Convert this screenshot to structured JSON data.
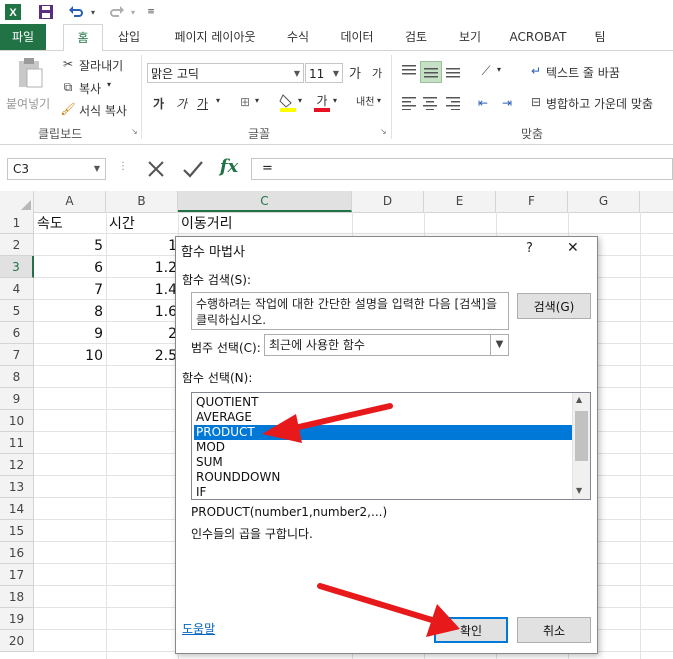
{
  "qat": {
    "app_icon": "excel-icon",
    "save_icon": "save-icon",
    "undo_icon": "undo-icon",
    "redo_icon": "redo-icon",
    "customize_icon": "customize-icon"
  },
  "tabs": [
    "파일",
    "홈",
    "삽입",
    "페이지 레이아웃",
    "수식",
    "데이터",
    "검토",
    "보기",
    "ACROBAT",
    "팀"
  ],
  "ribbon": {
    "clipboard": {
      "paste": "붙여넣기",
      "cut": "잘라내기",
      "copy": "복사",
      "format_painter": "서식 복사",
      "label": "클립보드"
    },
    "font": {
      "name": "맑은 고딕",
      "size": "11",
      "grow": "가",
      "shrink": "가",
      "bold": "가",
      "italic": "가",
      "underline": "가",
      "phonetic": "내천",
      "label": "글꼴"
    },
    "alignment": {
      "wrap": "텍스트 줄 바꿈",
      "merge": "병합하고 가운데 맞춤",
      "label": "맞춤"
    }
  },
  "formula_bar": {
    "name_box": "C3",
    "formula": "=",
    "fx": "fx"
  },
  "columns": [
    "A",
    "B",
    "C",
    "D",
    "E",
    "F",
    "G"
  ],
  "rows": [
    "1",
    "2",
    "3",
    "4",
    "5",
    "6",
    "7",
    "8",
    "9",
    "10",
    "11",
    "12",
    "13",
    "14",
    "15",
    "16",
    "17",
    "18",
    "19",
    "20"
  ],
  "cells": {
    "A1": "속도",
    "B1": "시간",
    "C1": "이동거리",
    "A2": "5",
    "B2": "1",
    "A3": "6",
    "B3": "1.2",
    "A4": "7",
    "B4": "1.4",
    "A5": "8",
    "B5": "1.6",
    "A6": "9",
    "B6": "2",
    "A7": "10",
    "B7": "2.5"
  },
  "dialog": {
    "title": "함수 마법사",
    "help_q": "?",
    "close": "✕",
    "search_label": "함수 검색(S):",
    "search_text": "수행하려는 작업에 대한 간단한 설명을 입력한 다음 [검색]을 클릭하십시오.",
    "search_button": "검색(G)",
    "category_label": "범주 선택(C):",
    "category_value": "최근에 사용한 함수",
    "function_label": "함수 선택(N):",
    "functions": [
      "QUOTIENT",
      "AVERAGE",
      "PRODUCT",
      "MOD",
      "SUM",
      "ROUNDDOWN",
      "IF"
    ],
    "selected_function": "PRODUCT",
    "signature": "PRODUCT(number1,number2,...)",
    "description": "인수들의 곱을 구합니다.",
    "help_link": "도움말",
    "ok": "확인",
    "cancel": "취소"
  },
  "colors": {
    "excel_green": "#217346",
    "selection_blue": "#0078d7",
    "arrow_red": "#e8191b"
  }
}
